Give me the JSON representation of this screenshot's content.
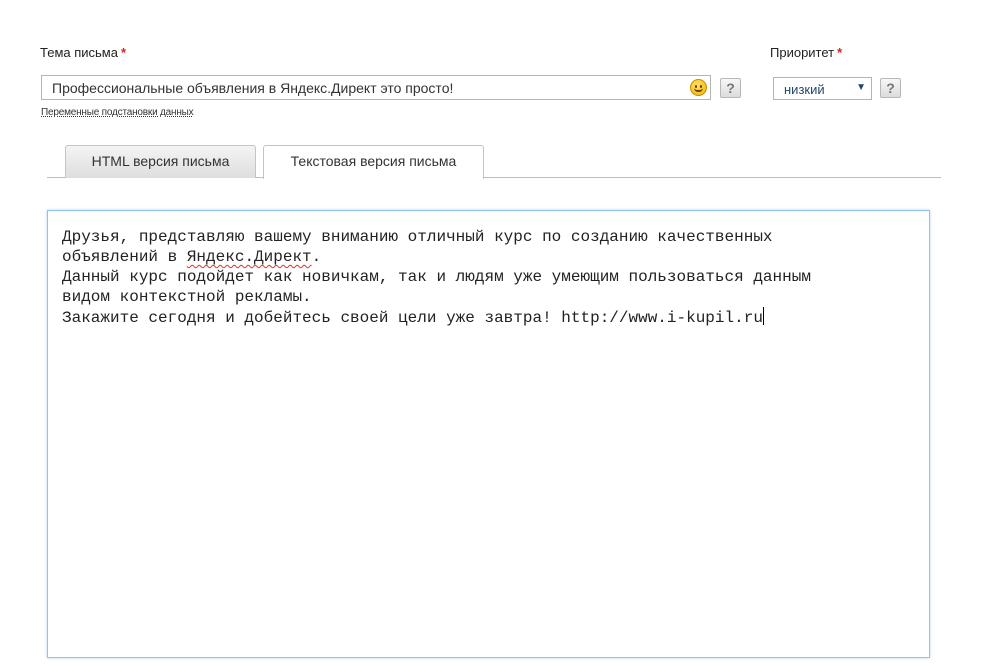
{
  "subject": {
    "label": "Тема письма",
    "required_mark": "*",
    "value": "Профессиональные объявления в Яндекс.Директ это просто!",
    "help": "?"
  },
  "priority": {
    "label": "Приоритет",
    "required_mark": "*",
    "selected": "низкий",
    "arrow": "▼",
    "help": "?"
  },
  "variables_link": "Переменные подстановки данных",
  "tabs": [
    {
      "label": "HTML версия письма",
      "active": false
    },
    {
      "label": "Текстовая версия письма",
      "active": true
    }
  ],
  "editor": {
    "lines": [
      "Друзья, представляю вашему вниманию отличный курс по созданию качественных",
      "объявлений в ",
      "Яндекс.Директ",
      ".",
      "Данный курс подойдет как новичкам, так и людям уже умеющим пользоваться данным",
      "видом контекстной рекламы.",
      "Закажите сегодня и добейтесь своей цели уже завтра! http://www.i-kupil.ru"
    ]
  },
  "colors": {
    "required": "#d9231d",
    "editor_border": "#8fc4e8",
    "select_text": "#24476e"
  }
}
